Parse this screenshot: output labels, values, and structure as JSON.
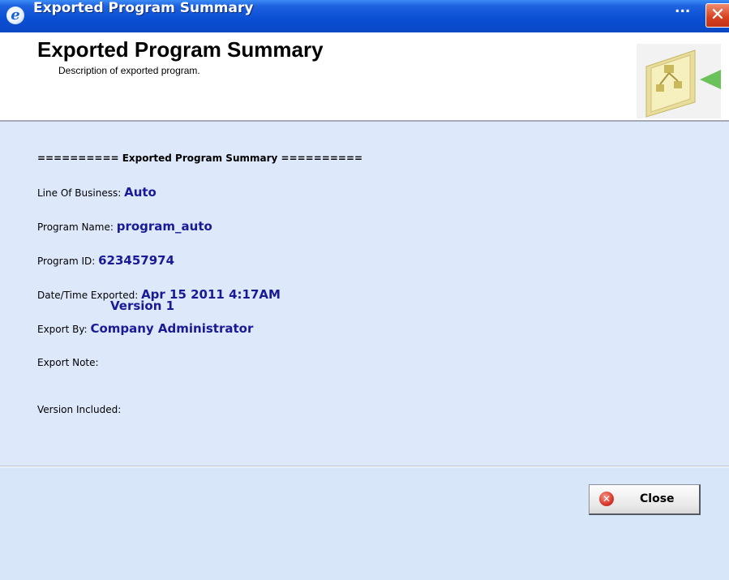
{
  "window": {
    "title": "Exported Program Summary",
    "title_overflow": "...",
    "close_glyph": "✕",
    "icon": "ie-e-icon"
  },
  "header": {
    "title": "Exported Program Summary",
    "description": "Description of exported program."
  },
  "summary": {
    "heading": "========== Exported Program Summary ==========",
    "line_of_business_label": "Line Of Business:",
    "line_of_business_value": "Auto",
    "program_name_label": "Program Name:",
    "program_name_value": "program_auto",
    "program_id_label": "Program ID:",
    "program_id_value": "623457974",
    "date_exported_label": "Date/Time Exported:",
    "date_exported_value": "Apr 15 2011 4:17AM",
    "export_by_label": "Export By:",
    "export_by_value": "Company Administrator",
    "export_note_label": "Export Note:",
    "version_included_label": "Version Included:",
    "versions": [
      "Version 1"
    ]
  },
  "footer": {
    "close_label": "Close"
  },
  "colors": {
    "title_bar": "#0a48c4",
    "content_bg": "#dde9fb",
    "value_text": "#1a1a96"
  }
}
